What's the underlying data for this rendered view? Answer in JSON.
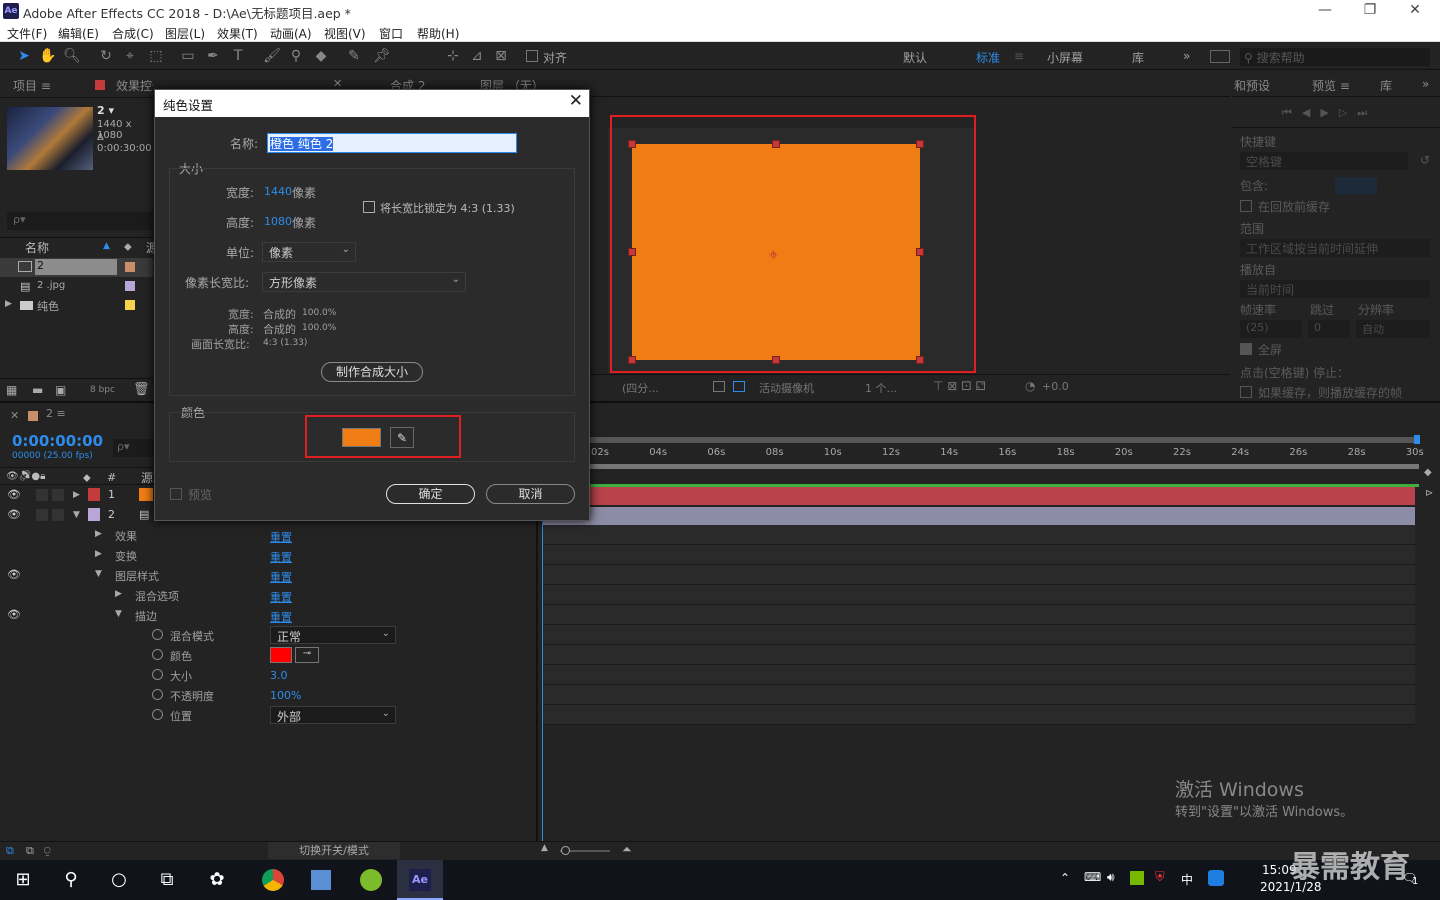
{
  "window": {
    "app_badge": "Ae",
    "title": "Adobe After Effects CC 2018 - D:\\Ae\\无标题项目.aep *",
    "min": "—",
    "max": "❐",
    "close": "✕"
  },
  "menu": [
    "文件(F)",
    "编辑(E)",
    "合成(C)",
    "图层(L)",
    "效果(T)",
    "动画(A)",
    "视图(V)",
    "窗口",
    "帮助(H)"
  ],
  "toolbar": {
    "align_label": "对齐",
    "workspaces": [
      "默认",
      "标准",
      "小屏幕",
      "库"
    ],
    "active_ws": "标准",
    "more": "»",
    "search_placeholder": "搜索帮助"
  },
  "project": {
    "tab": "项目 ≡",
    "effects_tab": "效果控件 橙色 纯色 1",
    "comp_name": "2 ▾",
    "comp_size": "1440 x 1080",
    "comp_dur": "Δ 0:00:30:00",
    "search": "ρ▾",
    "col_name": "名称",
    "col_src": "源",
    "items": [
      {
        "name": "2",
        "color": "#c98e6a"
      },
      {
        "name": "2 .jpg",
        "color": "#b9a6d9"
      },
      {
        "name": "纯色",
        "color": "#f5d34a"
      }
    ],
    "bpc": "8 bpc"
  },
  "comp_panel": {
    "tab": "合成 2",
    "layer_tab": "图层 （无）",
    "solid_color": "#f07d14",
    "zoom": "(四分...",
    "camera": "活动摄像机",
    "views": "1 个...",
    "offset": "+0.0"
  },
  "right_panel": {
    "tab1": "和预设",
    "tab2": "预览 ≡",
    "tab3": "库",
    "shortcut_lbl": "快捷键",
    "shortcut_val": "空格键",
    "include_lbl": "包含:",
    "cache_lbl": "在回放前缓存",
    "range_lbl": "范围",
    "range_val": "工作区域按当前时间延伸",
    "play_from_lbl": "播放自",
    "play_from_val": "当前时间",
    "fps_lbl": "帧速率",
    "skip_lbl": "跳过",
    "res_lbl": "分辨率",
    "fps_val": "(25)",
    "skip_val": "0",
    "res_val": "自动",
    "fullscreen": "全屏",
    "stop_lbl": "点击(空格键) 停止：",
    "stop_opt": "如果缓存，则播放缓存的帧"
  },
  "dialog": {
    "title": "纯色设置",
    "name_lbl": "名称:",
    "name_val": "橙色 纯色 2",
    "size_lbl": "大小",
    "width_lbl": "宽度:",
    "width_val": "1440",
    "width_unit": "像素",
    "height_lbl": "高度:",
    "height_val": "1080",
    "height_unit": "像素",
    "lock_lbl": "将长宽比锁定为 4:3 (1.33)",
    "unit_lbl": "单位:",
    "unit_val": "像素",
    "par_lbl": "像素长宽比:",
    "par_val": "方形像素",
    "w2_lbl": "宽度:",
    "w2_val": "合成的",
    "w2_pct": "100.0%",
    "h2_lbl": "高度:",
    "h2_val": "合成的",
    "h2_pct": "100.0%",
    "fa_lbl": "画面长宽比:",
    "fa_val": "4:3 (1.33)",
    "make_comp_btn": "制作合成大小",
    "color_lbl": "颜色",
    "swatch": "#f07d14",
    "preview_lbl": "预览",
    "ok": "确定",
    "cancel": "取消"
  },
  "timeline": {
    "tab": "2 ≡",
    "timecode": "0:00:00:00",
    "frames": "00000 (25.00 fps)",
    "search": "ρ▾",
    "col_num": "#",
    "col_src": "源",
    "layers": [
      {
        "num": "1",
        "color": "#c43b3b",
        "src_color": "#f07d14",
        "bar": "#b9434a"
      },
      {
        "num": "2",
        "color": "#b9a6d9",
        "src": "2 .jpg",
        "bar": "#8d8ca6"
      }
    ],
    "props": [
      {
        "name": "效果",
        "val": "重置",
        "ind": 1
      },
      {
        "name": "变换",
        "val": "重置",
        "ind": 1
      },
      {
        "name": "图层样式",
        "val": "重置",
        "ind": 1
      },
      {
        "name": "混合选项",
        "val": "重置",
        "ind": 2
      },
      {
        "name": "描边",
        "val": "重置",
        "ind": 2
      }
    ],
    "stroke_props": [
      {
        "name": "混合模式",
        "val": "正常",
        "type": "dd"
      },
      {
        "name": "颜色",
        "val": "#ff0000",
        "type": "color"
      },
      {
        "name": "大小",
        "val": "3.0",
        "type": "num"
      },
      {
        "name": "不透明度",
        "val": "100%",
        "type": "num"
      },
      {
        "name": "位置",
        "val": "外部",
        "type": "dd"
      }
    ],
    "ticks": [
      "02s",
      "04s",
      "06s",
      "08s",
      "10s",
      "12s",
      "14s",
      "16s",
      "18s",
      "20s",
      "22s",
      "24s",
      "26s",
      "28s",
      "30s"
    ],
    "switch_mode": "切换开关/模式"
  },
  "watermark": {
    "l1": "激活 Windows",
    "l2": "转到\"设置\"以激活 Windows。"
  },
  "taskbar": {
    "time": "15:09",
    "date": "2021/1/28",
    "ime": "中",
    "brand": "暴需教育",
    "ae": "Ae",
    "notif": "1"
  }
}
